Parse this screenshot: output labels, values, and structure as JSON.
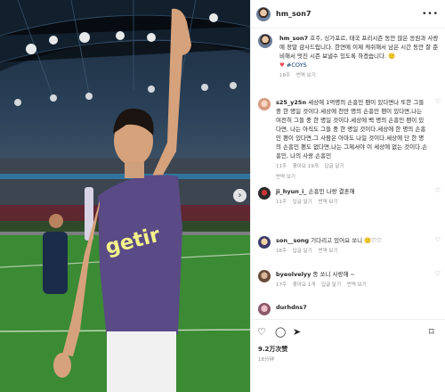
{
  "post": {
    "username": "hm_son7",
    "more_icon": "ellipsis-icon",
    "caption": {
      "text": "호주, 싱가포르, 태국 프리시즌 동안 많은 응원과 사랑에 정말 감사드립니다. 한연에 이제 케쉬해서 남은 시간 동안 잘 준비해서 멋진 시즌 보낼수 있도록 하겠습니다.",
      "emoji": "🙂",
      "heart": "♥",
      "hashtag": "#COYS",
      "time": "18주",
      "see_translation": "번역 보기"
    },
    "comments": [
      {
        "username": "s25_y25n",
        "text": "세상에 1억명의 손흥민 팬이 있다면나 또한 그들 중 한 명일 것이다.세상에 천만 명의 손흥민 팬이 있다면,나는 여전히 그들 중 한 명일 것이다.세상에 백 명의 손흥민 팬이 있다면, 나는 아직도 그들 중 한 명일 것이다.세상에 한 명의 손흥민 팬이 있다면,그 사람은 아마도 나일 것이다.세상에 단 한 명의 손흥민 팬도 없다면,나는 그제서야 이 세상에 없는 것이다.손흥민, 나의 사랑.손흥민",
        "time": "11주",
        "likes": "좋아요 19개",
        "reply": "답글 달기",
        "see_translation": "번역 보기"
      },
      {
        "username": "ji_hyun_i_",
        "text": "손흥민 나랑 결혼해",
        "time": "11주",
        "reply": "답글 달기",
        "see_translation": "번역 보기"
      },
      {
        "username": "son__song",
        "text": "기다리고 있어요 쏘니 🙂♡♡",
        "time": "16주",
        "reply": "답글 달기",
        "see_translation": "번역 보기"
      },
      {
        "username": "byeolvelyy",
        "text": "종 쏘니 사랑해 ~",
        "time": "17주",
        "likes": "좋아요 1개",
        "reply": "답글 달기",
        "see_translation": "번역 보기"
      },
      {
        "username": "durhdns7",
        "text": "",
        "time": "",
        "reply": "",
        "see_translation": ""
      }
    ],
    "actions": {
      "like_icon": "heart-outline-icon",
      "comment_icon": "comment-icon",
      "share_icon": "send-icon",
      "save_icon": "bookmark-icon"
    },
    "likes_count": "9.2万次赞",
    "posted_ago": "18分钟"
  },
  "photo": {
    "jersey_text": "getir"
  }
}
